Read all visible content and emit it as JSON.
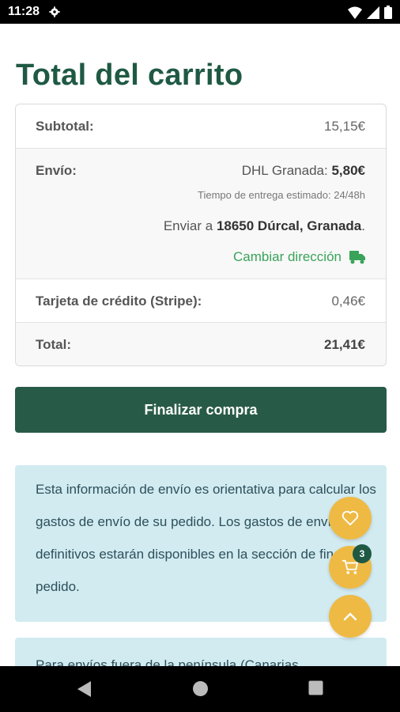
{
  "status_bar": {
    "time": "11:28"
  },
  "page": {
    "title": "Total del carrito"
  },
  "cart_totals": {
    "subtotal_label": "Subtotal:",
    "subtotal_value": "15,15€",
    "shipping_label": "Envío:",
    "carrier_name": "DHL Granada:",
    "carrier_price": "5,80€",
    "delivery_estimate": "Tiempo de entrega estimado: 24/48h",
    "ship_to_prefix": "Enviar a",
    "ship_to_address": "18650 Dúrcal, Granada",
    "ship_to_suffix": ".",
    "change_address": "Cambiar dirección",
    "payment_fee_label": "Tarjeta de crédito (Stripe):",
    "payment_fee_value": "0,46€",
    "total_label": "Total:",
    "total_value": "21,41€"
  },
  "checkout": {
    "button_label": "Finalizar compra"
  },
  "shipping_info": {
    "text": "Esta información de envío es orientativa para calcular los gastos de envío de su pedido. Los gastos de envío definitivos estarán disponibles en la sección de finalizar pedido.",
    "text2": "Para envíos fuera de la península (Canarias"
  },
  "floating_buttons": {
    "cart_count": "3"
  },
  "colors": {
    "brand_green": "#1f5944",
    "button_green": "#285b47",
    "link_green": "#3aa35a",
    "fab_yellow": "#eeba44",
    "info_bg": "#d1ebf1"
  },
  "icons": [
    "settings-icon",
    "wifi-icon",
    "signal-icon",
    "battery-icon",
    "truck-icon",
    "heart-icon",
    "cart-icon",
    "chevron-up-icon",
    "back-icon",
    "home-icon",
    "recents-icon"
  ]
}
